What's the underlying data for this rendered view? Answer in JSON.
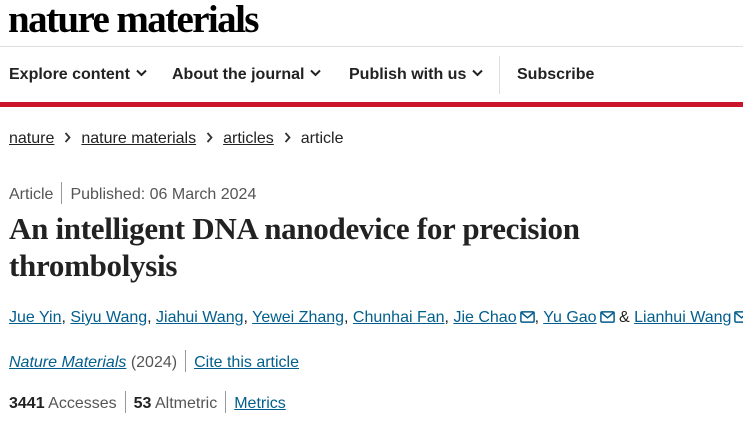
{
  "site": {
    "logo_text": "nature materials"
  },
  "nav": {
    "items": [
      {
        "label": "Explore content"
      },
      {
        "label": "About the journal"
      },
      {
        "label": "Publish with us"
      }
    ],
    "subscribe_label": "Subscribe"
  },
  "breadcrumb": {
    "items": [
      {
        "label": "nature"
      },
      {
        "label": "nature materials"
      },
      {
        "label": "articles"
      }
    ],
    "current": "article"
  },
  "article": {
    "type": "Article",
    "published": "Published: 06 March 2024",
    "title": "An intelligent DNA nanodevice for precision thrombolysis",
    "authors": [
      {
        "name": "Jue Yin",
        "separator": ", "
      },
      {
        "name": "Siyu Wang",
        "separator": ", "
      },
      {
        "name": "Jiahui Wang",
        "separator": ", "
      },
      {
        "name": "Yewei Zhang",
        "separator": ", "
      },
      {
        "name": "Chunhai Fan",
        "separator": ", "
      },
      {
        "name": "Jie Chao",
        "separator": ", "
      },
      {
        "name": "Yu Gao",
        "separator": " & "
      },
      {
        "name": "Lianhui Wang",
        "separator": ""
      }
    ],
    "journal": "Nature Materials",
    "year": "(2024)",
    "cite_label": "Cite this article",
    "accesses_count": "3441",
    "accesses_label": "Accesses",
    "altmetric_count": "53",
    "altmetric_label": "Altmetric",
    "metrics_label": "Metrics"
  },
  "colors": {
    "accent_red": "#c9142b",
    "link_blue": "#025e8d",
    "text": "#222222",
    "muted": "#555555"
  },
  "icons": {
    "nav_dropdown": "chevron-down-icon",
    "breadcrumb_separator": "chevron-right-icon",
    "corresponding_author": "mail-icon"
  }
}
